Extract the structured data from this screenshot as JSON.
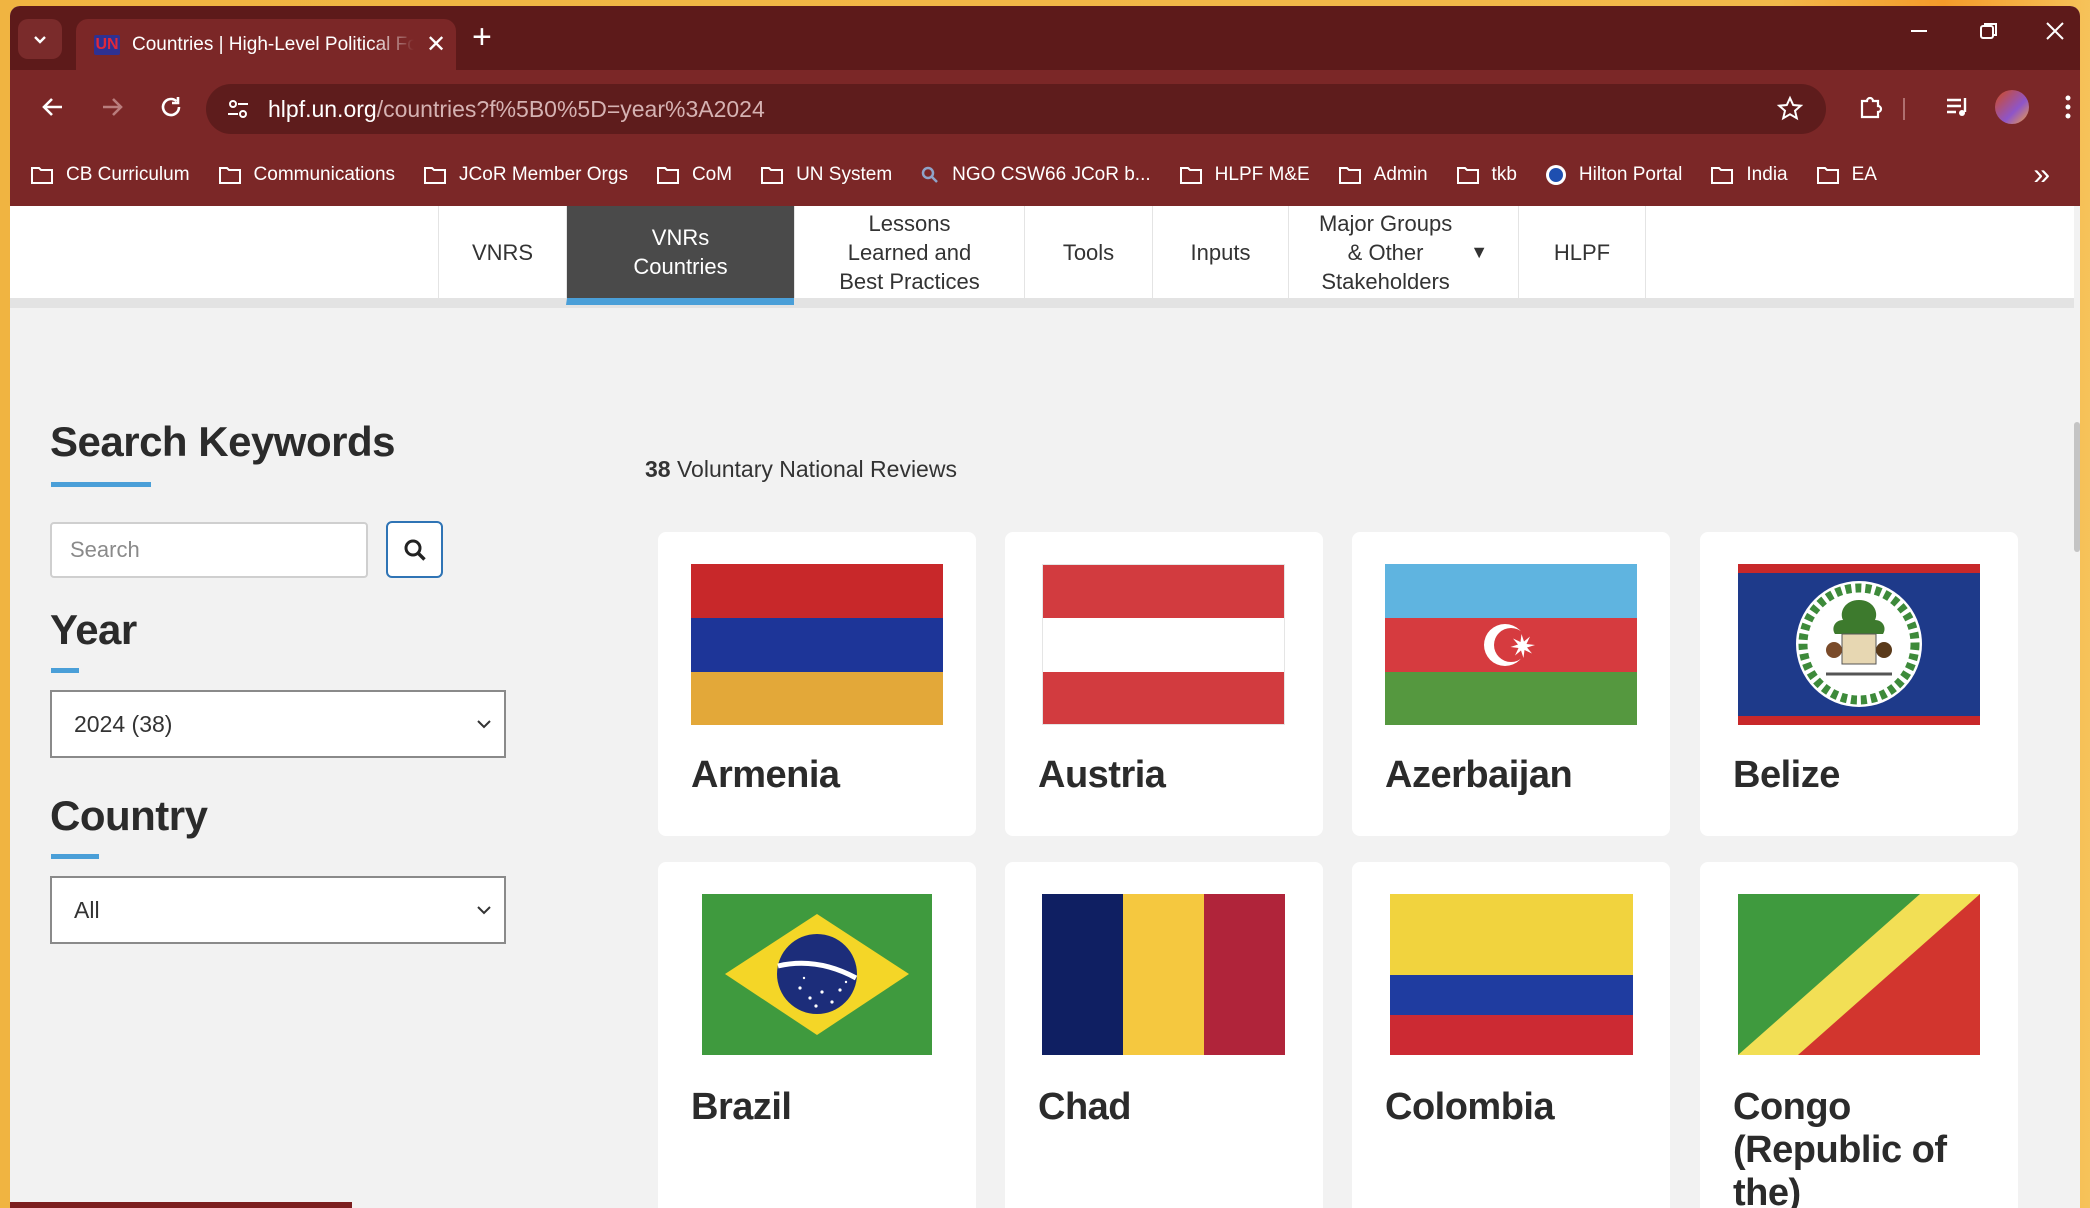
{
  "browser": {
    "tab_title": "Countries | High-Level Political Forum",
    "favicon_text": "UN",
    "url_host": "hlpf.un.org",
    "url_path": "/countries?f%5B0%5D=year%3A2024",
    "bookmarks": [
      "CB Curriculum",
      "Communications",
      "JCoR Member Orgs",
      "CoM",
      "UN System",
      "NGO CSW66 JCoR b...",
      "HLPF M&E",
      "Admin",
      "tkb",
      "Hilton Portal",
      "India",
      "EA"
    ]
  },
  "nav": {
    "items": [
      {
        "label": "VNRS"
      },
      {
        "label": "VNRs\nCountries",
        "active": true
      },
      {
        "label": "Lessons\nLearned and\nBest Practices"
      },
      {
        "label": "Tools"
      },
      {
        "label": "Inputs"
      },
      {
        "label": "Major Groups\n& Other\nStakeholders",
        "dropdown": true
      },
      {
        "label": "HLPF"
      }
    ]
  },
  "sidebar": {
    "search_heading": "Search Keywords",
    "search_placeholder": "Search",
    "year_heading": "Year",
    "year_value": "2024 (38)",
    "country_heading": "Country",
    "country_value": "All"
  },
  "results": {
    "count": "38",
    "label": "Voluntary National Reviews"
  },
  "countries": [
    {
      "name": "Armenia"
    },
    {
      "name": "Austria"
    },
    {
      "name": "Azerbaijan"
    },
    {
      "name": "Belize"
    },
    {
      "name": "Brazil"
    },
    {
      "name": "Chad"
    },
    {
      "name": "Colombia"
    },
    {
      "name": "Congo (Republic of the)"
    }
  ],
  "colors": {
    "chrome_dark": "#5d1a1a",
    "chrome": "#7b2727",
    "accent_blue": "#4a9fd8",
    "nav_active": "#4a4a4a"
  }
}
